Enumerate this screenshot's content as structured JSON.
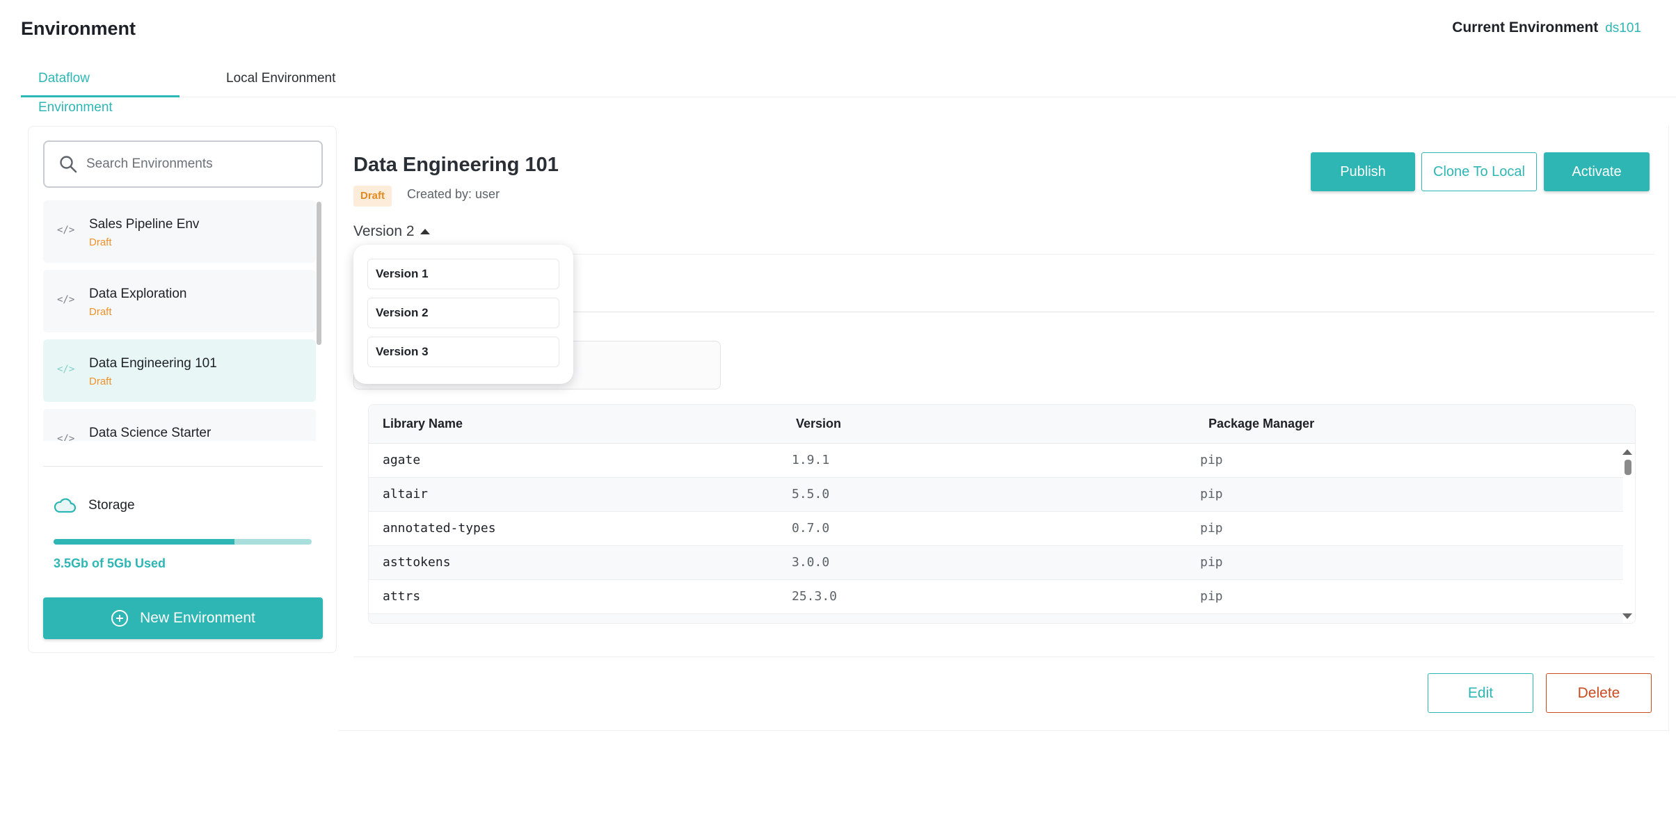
{
  "header": {
    "title": "Environment",
    "current_env_label": "Current Environment",
    "current_env_value": "ds101"
  },
  "tabs": [
    {
      "label": "Dataflow Environment",
      "active": true
    },
    {
      "label": "Local Environment",
      "active": false
    }
  ],
  "sidebar": {
    "search_placeholder": "Search Environments",
    "environments": [
      {
        "name": "Sales Pipeline Env",
        "status": "Draft",
        "icon": "code-icon"
      },
      {
        "name": "Data Exploration",
        "status": "Draft",
        "icon": "code-icon"
      },
      {
        "name": "Data Engineering 101",
        "status": "Draft",
        "icon": "code-icon",
        "selected": true
      },
      {
        "name": "Data Science Starter",
        "status": "",
        "icon": "code-icon"
      }
    ],
    "storage": {
      "label": "Storage",
      "icon": "cloud-icon",
      "used_fraction": 0.7,
      "used_text": "3.5Gb of 5Gb Used"
    },
    "new_env_label": "New Environment",
    "new_env_icon": "plus-circle-icon"
  },
  "main": {
    "title": "Data Engineering 101",
    "badge": "Draft",
    "created_by": "Created by: user",
    "buttons": {
      "publish": "Publish",
      "clone": "Clone To Local",
      "activate": "Activate",
      "edit": "Edit",
      "delete": "Delete"
    },
    "version_selected": "Version 2",
    "version_options": [
      "Version 1",
      "Version 2",
      "Version 3"
    ],
    "table": {
      "columns": [
        "Library Name",
        "Version",
        "Package Manager"
      ],
      "rows": [
        [
          "agate",
          "1.9.1",
          "pip"
        ],
        [
          "altair",
          "5.5.0",
          "pip"
        ],
        [
          "annotated-types",
          "0.7.0",
          "pip"
        ],
        [
          "asttokens",
          "3.0.0",
          "pip"
        ],
        [
          "attrs",
          "25.3.0",
          "pip"
        ]
      ]
    }
  },
  "colors": {
    "accent": "#2eb6b4",
    "draft": "#f0922b",
    "danger": "#c84a1f"
  }
}
